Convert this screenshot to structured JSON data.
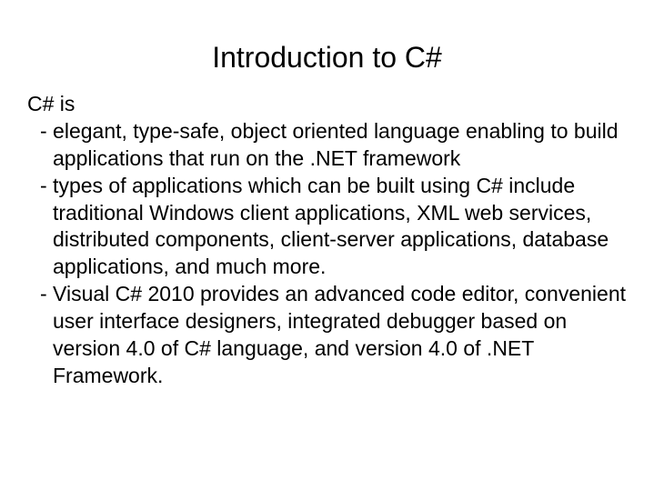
{
  "slide": {
    "title": "Introduction to C#",
    "intro": "C# is",
    "bullets": [
      "- elegant, type-safe, object oriented language enabling to build applications that run on the .NET framework",
      "- types of applications which can be built using C# include traditional Windows client applications, XML web services, distributed components, client-server applications, database applications, and much more.",
      "- Visual C# 2010 provides an advanced code editor, convenient user interface designers, integrated debugger based on version 4.0 of C# language, and version 4.0 of .NET Framework."
    ]
  }
}
